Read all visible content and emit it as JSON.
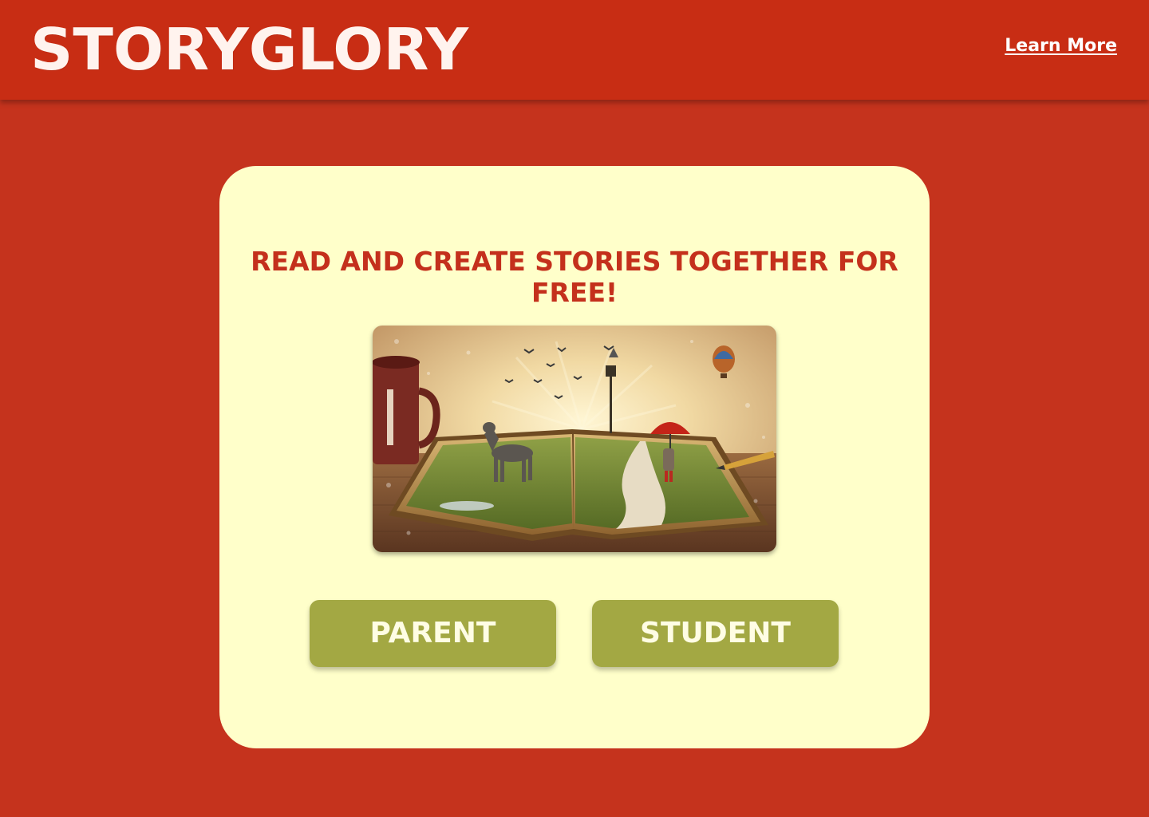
{
  "header": {
    "logo": "STORYGLORY",
    "learn_more": "Learn More"
  },
  "main": {
    "tagline": "READ AND CREATE STORIES TOGETHER FOR FREE!",
    "buttons": {
      "parent": "PARENT",
      "student": "STUDENT"
    }
  },
  "colors": {
    "background": "#c5331d",
    "header": "#c82d14",
    "card": "#ffffca",
    "accent_text": "#c4301c",
    "button": "#a3a843"
  }
}
